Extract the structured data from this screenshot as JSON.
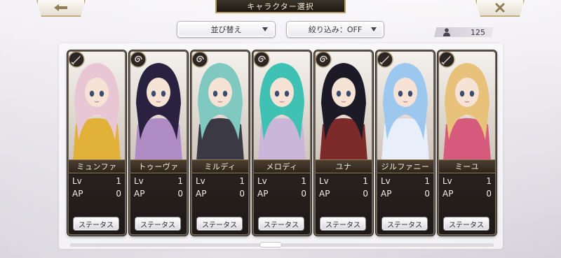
{
  "header": {
    "title": "キャラクター選択",
    "back_icon": "back-arrow-icon",
    "close_icon": "close-x-icon"
  },
  "toolbar": {
    "sort_label": "並び替え",
    "filter_label": "絞り込み：OFF",
    "count": "125"
  },
  "cards": [
    {
      "name": "ミュンファ",
      "lv_label": "Lv",
      "lv": "1",
      "ap_label": "AP",
      "ap": "0",
      "button": "ステータス",
      "type_icon": "sword-icon",
      "hair": "#e9c6d3",
      "outfit": "#e2b13a"
    },
    {
      "name": "トゥーヴァ",
      "lv_label": "Lv",
      "lv": "1",
      "ap_label": "AP",
      "ap": "0",
      "button": "ステータス",
      "type_icon": "spiral-icon",
      "hair": "#2a2140",
      "outfit": "#b08cc4"
    },
    {
      "name": "ミルディ",
      "lv_label": "Lv",
      "lv": "1",
      "ap_label": "AP",
      "ap": "0",
      "button": "ステータス",
      "type_icon": "spiral-icon",
      "hair": "#7fc9c0",
      "outfit": "#3b3a44"
    },
    {
      "name": "メロディ",
      "lv_label": "Lv",
      "lv": "1",
      "ap_label": "AP",
      "ap": "0",
      "button": "ステータス",
      "type_icon": "spiral-icon",
      "hair": "#3fc1b4",
      "outfit": "#c9b6d8"
    },
    {
      "name": "ユナ",
      "lv_label": "Lv",
      "lv": "1",
      "ap_label": "AP",
      "ap": "0",
      "button": "ステータス",
      "type_icon": "spiral-icon",
      "hair": "#1c1a26",
      "outfit": "#7d2a2a"
    },
    {
      "name": "ジルファニー",
      "lv_label": "Lv",
      "lv": "1",
      "ap_label": "AP",
      "ap": "0",
      "button": "ステータス",
      "type_icon": "sword-icon",
      "hair": "#9cc8ef",
      "outfit": "#e8eefa"
    },
    {
      "name": "ミーユ",
      "lv_label": "Lv",
      "lv": "1",
      "ap_label": "AP",
      "ap": "0",
      "button": "ステータス",
      "type_icon": "sword-icon",
      "hair": "#e8c27a",
      "outfit": "#d65a7b"
    }
  ]
}
